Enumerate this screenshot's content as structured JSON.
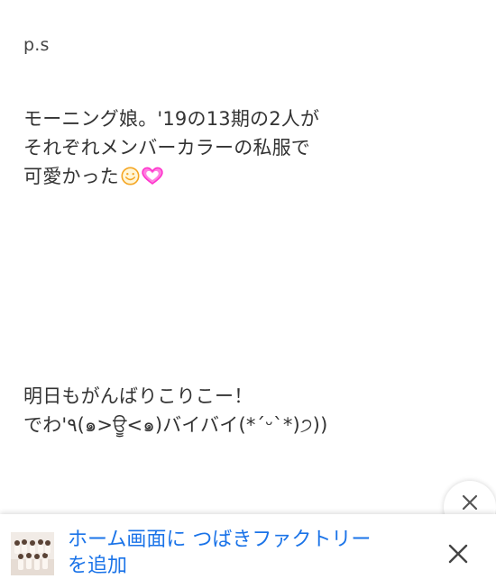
{
  "article": {
    "ps": "p.s",
    "para1_line1": "モーニング娘。'19の13期の2人が",
    "para1_line2": "それぞれメンバーカラーの私服で",
    "para1_line3": "可愛かった",
    "para2_line1": "明日もがんばりこりこー！",
    "para2_line2": "でわ'٩(๑>ਊ<๑)バイバイ(*ˊᵕˋ*)੭))"
  },
  "emojis": [
    "smiling-face-icon",
    "sparkling-heart-icon"
  ],
  "banner": {
    "line1": "ホーム画面に つばきファクトリー",
    "line2": "を追加"
  },
  "colors": {
    "banner_text": "#1a73e8",
    "heart": "#ff33cc",
    "smile": "#f5a623"
  }
}
